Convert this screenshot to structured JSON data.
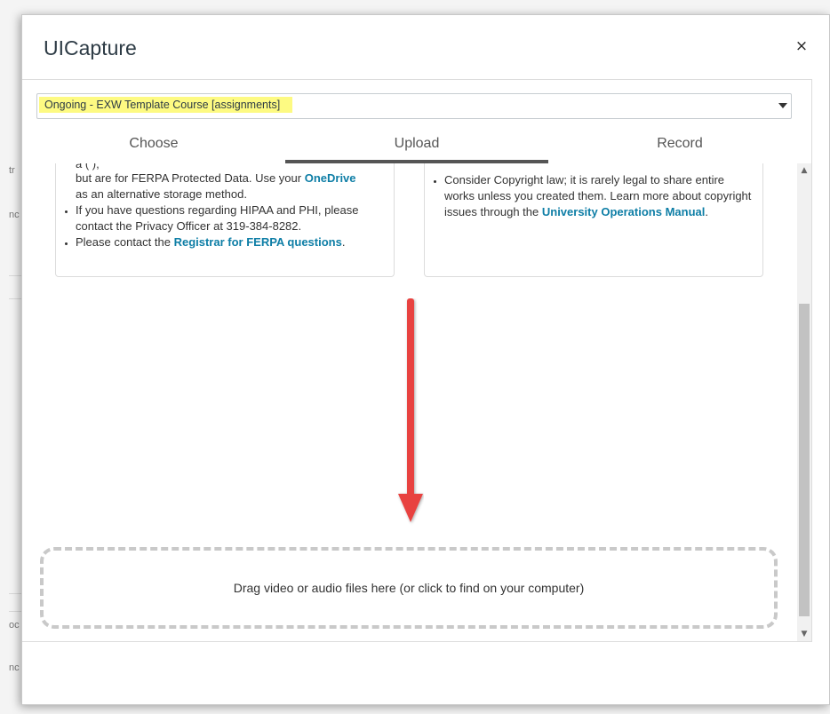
{
  "background": {
    "fragments": [
      "tr",
      "nc",
      "oc",
      "nc"
    ]
  },
  "modal": {
    "title": "UICapture",
    "close_label": "×"
  },
  "course_select": {
    "value": "Ongoing - EXW Template Course [assignments]",
    "highlight_color": "#fdfa82"
  },
  "tabs": [
    {
      "label": "Choose",
      "active": false
    },
    {
      "label": "Upload",
      "active": true
    },
    {
      "label": "Record",
      "active": false
    }
  ],
  "left_box": {
    "partial_top": "a                                                       (  ),",
    "item1_pre": "but are for FERPA Protected Data. Use your ",
    "item1_link": "OneDrive",
    "item1_post": "as an alternative storage method.",
    "item2": "If you have questions regarding HIPAA and PHI, please contact the Privacy Officer at 319-384-8282.",
    "item3_pre": "Please contact the ",
    "item3_link": "Registrar for FERPA questions",
    "item3_post": "."
  },
  "right_box": {
    "item1_pre": "Consider Copyright law; it is rarely legal to share entire works unless you created them. Learn more about copyright issues through the ",
    "item1_link": "University Operations Manual",
    "item1_post": "."
  },
  "dropzone": {
    "text": "Drag video or audio files here (or click to find on your computer)"
  },
  "colors": {
    "link": "#0e7ea6",
    "annotation_arrow": "#e8423f"
  },
  "icons": {
    "close": "close-icon",
    "dropdown": "chevron-down-icon",
    "scroll_up": "chevron-up-icon",
    "scroll_down": "chevron-down-icon",
    "annotation": "arrow-down-icon"
  }
}
